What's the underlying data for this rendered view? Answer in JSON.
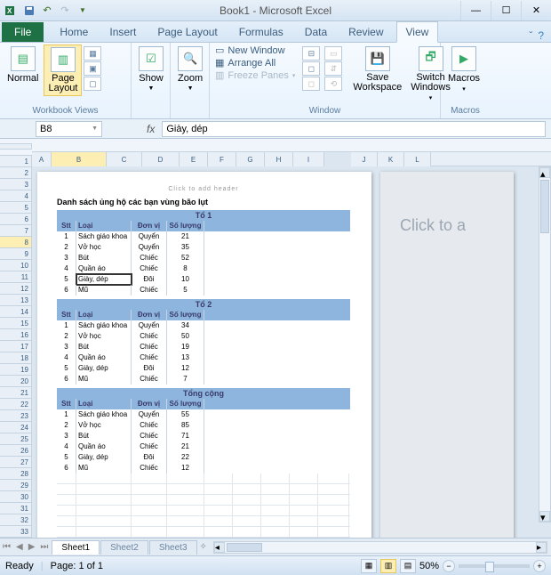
{
  "app": {
    "title": "Book1 - Microsoft Excel"
  },
  "qat": {
    "icon": "X"
  },
  "tabs": {
    "file": "File",
    "list": [
      "Home",
      "Insert",
      "Page Layout",
      "Formulas",
      "Data",
      "Review",
      "View"
    ],
    "active": "View"
  },
  "ribbon": {
    "workbook_views": {
      "label": "Workbook Views",
      "normal": "Normal",
      "page_layout": "Page\nLayout"
    },
    "show": "Show",
    "zoom": "Zoom",
    "window": {
      "label": "Window",
      "new_window": "New Window",
      "arrange_all": "Arrange All",
      "freeze_panes": "Freeze Panes",
      "save_ws": "Save\nWorkspace",
      "switch": "Switch\nWindows"
    },
    "macros": {
      "label": "Macros",
      "btn": "Macros"
    }
  },
  "namebox": {
    "ref": "B8",
    "fx": "fx",
    "formula": "Giày, dép"
  },
  "columns": [
    "A",
    "B",
    "C",
    "D",
    "E",
    "F",
    "G",
    "H",
    "I"
  ],
  "columns2": [
    "J",
    "K",
    "L"
  ],
  "selected_col": "B",
  "selected_row": 8,
  "page": {
    "header_ph": "Click to add header",
    "title": "Danh sách ủng hộ các bạn vùng bão lụt",
    "headers": [
      "Stt",
      "Loại",
      "Đơn vị",
      "Số lượng"
    ],
    "sections": [
      {
        "title": "Tổ 1",
        "rows": [
          [
            "1",
            "Sách giáo khoa",
            "Quyển",
            "21"
          ],
          [
            "2",
            "Vở học",
            "Quyển",
            "35"
          ],
          [
            "3",
            "Bút",
            "Chiếc",
            "52"
          ],
          [
            "4",
            "Quần áo",
            "Chiếc",
            "8"
          ],
          [
            "5",
            "Giày, dép",
            "Đôi",
            "10"
          ],
          [
            "6",
            "Mũ",
            "Chiếc",
            "5"
          ]
        ]
      },
      {
        "title": "Tổ 2",
        "rows": [
          [
            "1",
            "Sách giáo khoa",
            "Quyển",
            "34"
          ],
          [
            "2",
            "Vở học",
            "Chiếc",
            "50"
          ],
          [
            "3",
            "Bút",
            "Chiếc",
            "19"
          ],
          [
            "4",
            "Quần áo",
            "Chiếc",
            "13"
          ],
          [
            "5",
            "Giày, dép",
            "Đôi",
            "12"
          ],
          [
            "6",
            "Mũ",
            "Chiếc",
            "7"
          ]
        ]
      },
      {
        "title": "Tổng cộng",
        "rows": [
          [
            "1",
            "Sách giáo khoa",
            "Quyển",
            "55"
          ],
          [
            "2",
            "Vở học",
            "Chiếc",
            "85"
          ],
          [
            "3",
            "Bút",
            "Chiếc",
            "71"
          ],
          [
            "4",
            "Quần áo",
            "Chiếc",
            "21"
          ],
          [
            "5",
            "Giày, dép",
            "Đôi",
            "22"
          ],
          [
            "6",
            "Mũ",
            "Chiếc",
            "12"
          ]
        ]
      }
    ]
  },
  "page2_ph": "Click to a",
  "sheets": {
    "active": "Sheet1",
    "list": [
      "Sheet1",
      "Sheet2",
      "Sheet3"
    ]
  },
  "status": {
    "ready": "Ready",
    "page": "Page: 1 of 1",
    "zoom": "50%"
  },
  "chart_data": {
    "type": "table",
    "title": "Danh sách ủng hộ các bạn vùng bão lụt",
    "columns": [
      "Stt",
      "Loại",
      "Đơn vị",
      "Số lượng"
    ],
    "groups": [
      {
        "name": "Tổ 1",
        "rows": [
          [
            "1",
            "Sách giáo khoa",
            "Quyển",
            21
          ],
          [
            "2",
            "Vở học",
            "Quyển",
            35
          ],
          [
            "3",
            "Bút",
            "Chiếc",
            52
          ],
          [
            "4",
            "Quần áo",
            "Chiếc",
            8
          ],
          [
            "5",
            "Giày, dép",
            "Đôi",
            10
          ],
          [
            "6",
            "Mũ",
            "Chiếc",
            5
          ]
        ]
      },
      {
        "name": "Tổ 2",
        "rows": [
          [
            "1",
            "Sách giáo khoa",
            "Quyển",
            34
          ],
          [
            "2",
            "Vở học",
            "Chiếc",
            50
          ],
          [
            "3",
            "Bút",
            "Chiếc",
            19
          ],
          [
            "4",
            "Quần áo",
            "Chiếc",
            13
          ],
          [
            "5",
            "Giày, dép",
            "Đôi",
            12
          ],
          [
            "6",
            "Mũ",
            "Chiếc",
            7
          ]
        ]
      },
      {
        "name": "Tổng cộng",
        "rows": [
          [
            "1",
            "Sách giáo khoa",
            "Quyển",
            55
          ],
          [
            "2",
            "Vở học",
            "Chiếc",
            85
          ],
          [
            "3",
            "Bút",
            "Chiếc",
            71
          ],
          [
            "4",
            "Quần áo",
            "Chiếc",
            21
          ],
          [
            "5",
            "Giày, dép",
            "Đôi",
            22
          ],
          [
            "6",
            "Mũ",
            "Chiếc",
            12
          ]
        ]
      }
    ]
  }
}
